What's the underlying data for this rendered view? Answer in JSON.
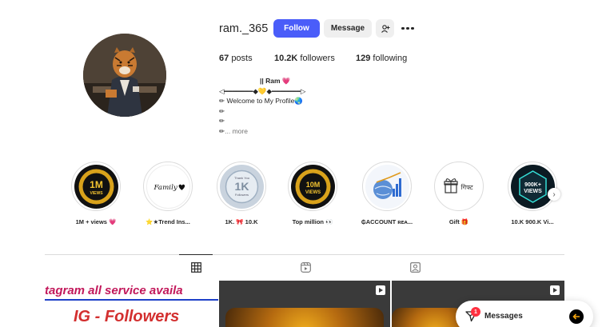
{
  "profile": {
    "username": "ram._365",
    "follow_label": "Follow",
    "message_label": "Message",
    "posts_count": "67",
    "posts_label": "posts",
    "followers_count": "10.2K",
    "followers_label": "followers",
    "following_count": "129",
    "following_label": "following"
  },
  "bio": {
    "name_line": "|| Ram 💗",
    "divider_line": "◁━━━━━━━◆💛◆━━━━━━━▷",
    "line1": "✏ Welcome to My Profile🌏",
    "line2": "✏",
    "line3": "✏",
    "more_prefix": "✏",
    "more_label": "... more"
  },
  "highlights": [
    {
      "label": "1M + views 💗",
      "icon": "1m-views-badge"
    },
    {
      "label": "⭐★Trend Ins...",
      "icon": "family-heart"
    },
    {
      "label": "1K. 🎀 10.K",
      "icon": "1k-followers-badge"
    },
    {
      "label": "Top million 👀",
      "icon": "10m-views-badge"
    },
    {
      "label": "₲ACCOUNT ʀᴇᴀ...",
      "icon": "globe-growth"
    },
    {
      "label": "Gift 🎁",
      "icon": "gift-icon"
    },
    {
      "label": "10.K 900.K Vi...",
      "icon": "900k-views-badge"
    }
  ],
  "highlight_texts": {
    "h1_top": "1M",
    "h1_bottom": "VIEWS",
    "h2_text": "Family",
    "h3_top": "Thank You",
    "h3_mid": "1K",
    "h3_bottom": "Followers",
    "h4_top": "10M",
    "h4_bottom": "VIEWS",
    "h6_text": "गिफ्ट",
    "h7_top": "900K+",
    "h7_bottom": "VIEWS"
  },
  "grid": {
    "tile1_top": "tagram all service availa",
    "tile1_bottom": "IG - Followers"
  },
  "messages": {
    "label": "Messages",
    "badge": "1"
  },
  "colors": {
    "follow_bg": "#4a5df9",
    "badge_red": "#ff3040"
  }
}
